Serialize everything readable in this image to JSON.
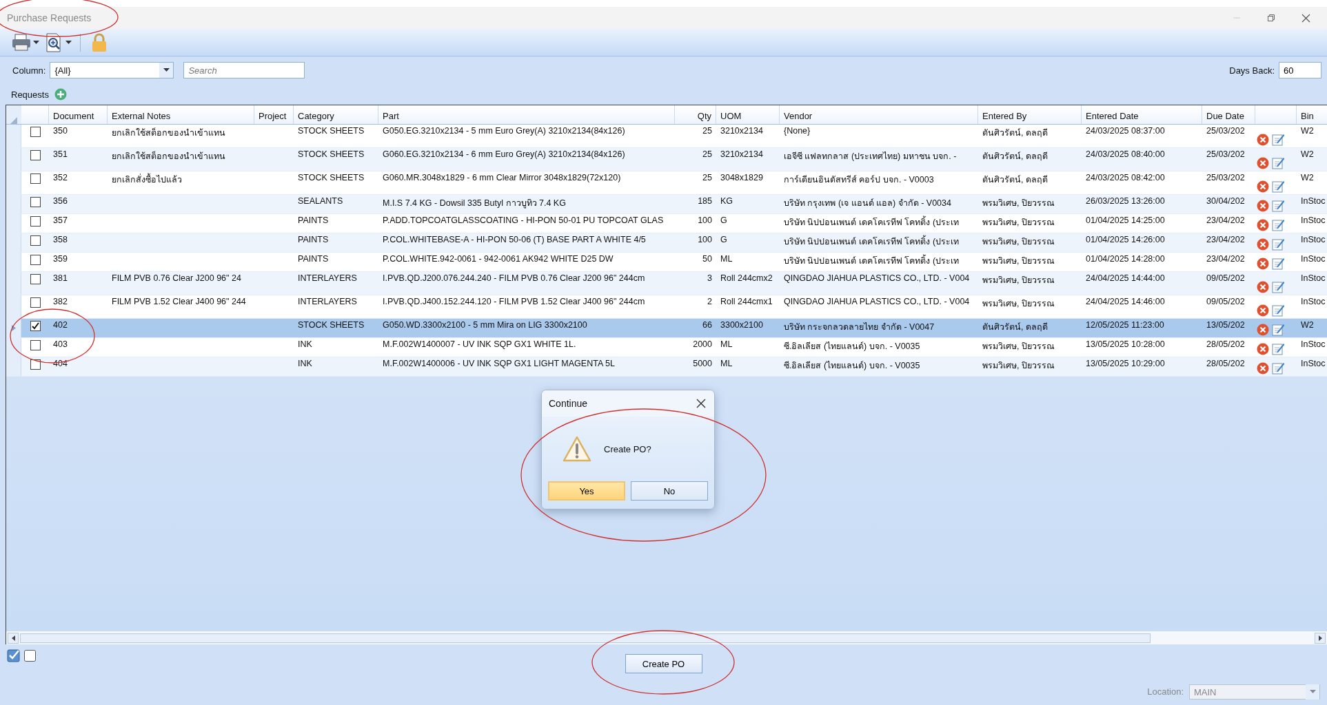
{
  "window": {
    "title": "Purchase Requests",
    "circled": true
  },
  "toolbar": {
    "items": [
      {
        "kind": "print",
        "dropdown": true
      },
      {
        "kind": "preview",
        "dropdown": true
      },
      {
        "kind": "lock",
        "dropdown": false
      }
    ]
  },
  "filter": {
    "column_label": "Column:",
    "column_value": "{All}",
    "search_placeholder": "Search",
    "days_back_label": "Days Back:",
    "days_back_value": "60"
  },
  "requests_label": "Requests",
  "table": {
    "columns": [
      "Document",
      "External Notes",
      "Project",
      "Category",
      "Part",
      "Qty",
      "UOM",
      "Vendor",
      "Entered By",
      "Entered Date",
      "Due Date",
      "Bin"
    ],
    "rows": [
      {
        "document": "350",
        "external_notes": "ยกเลิกใช้สต็อกของนำเข้าแทน",
        "category": "STOCK SHEETS",
        "part": "G050.EG.3210x2134 - 5 mm Euro Grey(A) 3210x2134(84x126)",
        "qty": "25",
        "uom": "3210x2134",
        "vendor": "{None}",
        "entered_by": "ตันศิวรัตน์, ดลฤดี",
        "entered_date": "24/03/2025 08:37:00",
        "due_date": "25/03/202",
        "bin": "W2",
        "checked": false,
        "selected": false,
        "circled": false
      },
      {
        "document": "351",
        "external_notes": "ยกเลิกใช้สต็อกของนำเข้าแทน",
        "category": "STOCK SHEETS",
        "part": "G060.EG.3210x2134 - 6 mm Euro Grey(A) 3210x2134(84x126)",
        "qty": "25",
        "uom": "3210x2134",
        "vendor": "เอจีซี แฟลทกลาส (ประเทศไทย) มหาชน บจก. -",
        "entered_by": "ตันศิวรัตน์, ดลฤดี",
        "entered_date": "24/03/2025 08:40:00",
        "due_date": "25/03/202",
        "bin": "W2",
        "checked": false,
        "selected": false,
        "circled": false
      },
      {
        "document": "352",
        "external_notes": "ยกเลิกสั่งซื้อไปแล้ว",
        "category": "STOCK SHEETS",
        "part": "G060.MR.3048x1829 - 6 mm Clear Mirror 3048x1829(72x120)",
        "qty": "25",
        "uom": "3048x1829",
        "vendor": "การ์เดียนอินดัสทรีส์ คอร์ป บจก. - V0003",
        "entered_by": "ตันศิวรัตน์, ดลฤดี",
        "entered_date": "24/03/2025 08:42:00",
        "due_date": "25/03/202",
        "bin": "W2",
        "checked": false,
        "selected": false,
        "circled": false
      },
      {
        "document": "356",
        "category": "SEALANTS",
        "part": "M.I.S 7.4 KG - Dowsil 335 Butyl กาวบูทิว 7.4 KG",
        "qty": "185",
        "uom": "KG",
        "vendor": "บริษัท กรุงเทพ (เจ แอนด์ แอล) จำกัด - V0034",
        "entered_by": "พรมวิเศษ, ปิยวรรณ",
        "entered_date": "26/03/2025 13:26:00",
        "due_date": "30/04/202",
        "bin": "InStoc",
        "checked": false,
        "selected": false,
        "circled": false
      },
      {
        "document": "357",
        "category": "PAINTS",
        "part": "P.ADD.TOPCOATGLASSCOATING - HI-PON 50-01 PU TOPCOAT GLAS",
        "qty": "100",
        "uom": "G",
        "vendor": "บริษัท นิปปอนเพนต์ เดคโคเรทีฟ โคทติ้ง (ประเท",
        "entered_by": "พรมวิเศษ, ปิยวรรณ",
        "entered_date": "01/04/2025 14:25:00",
        "due_date": "23/04/202",
        "bin": "InStoc",
        "checked": false,
        "selected": false,
        "circled": false
      },
      {
        "document": "358",
        "category": "PAINTS",
        "part": "P.COL.WHITEBASE-A - HI-PON 50-06 (T)  BASE PART A WHITE 4/5",
        "qty": "100",
        "uom": "G",
        "vendor": "บริษัท นิปปอนเพนต์ เดคโคเรทีฟ โคทติ้ง (ประเท",
        "entered_by": "พรมวิเศษ, ปิยวรรณ",
        "entered_date": "01/04/2025 14:26:00",
        "due_date": "23/04/202",
        "bin": "InStoc",
        "checked": false,
        "selected": false,
        "circled": false
      },
      {
        "document": "359",
        "category": "PAINTS",
        "part": "P.COL.WHITE.942-0061 - 942-0061 AK942 WHITE D25 DW",
        "qty": "50",
        "uom": "ML",
        "vendor": "บริษัท นิปปอนเพนต์ เดคโคเรทีฟ โคทติ้ง (ประเท",
        "entered_by": "พรมวิเศษ, ปิยวรรณ",
        "entered_date": "01/04/2025 14:28:00",
        "due_date": "23/04/202",
        "bin": "InStoc",
        "checked": false,
        "selected": false,
        "circled": false
      },
      {
        "document": "381",
        "external_notes": "FILM PVB 0.76 Clear J200  96\" 24",
        "category": "INTERLAYERS",
        "part": "I.PVB.QD.J200.076.244.240 - FILM PVB 0.76 Clear J200  96\" 244cm",
        "qty": "3",
        "uom": "Roll 244cmx2",
        "vendor": "QINGDAO JIAHUA PLASTICS CO., LTD. - V004",
        "entered_by": "พรมวิเศษ, ปิยวรรณ",
        "entered_date": "24/04/2025 14:44:00",
        "due_date": "09/05/202",
        "bin": "InStoc",
        "checked": false,
        "selected": false,
        "circled": false
      },
      {
        "document": "382",
        "external_notes": "FILM PVB 1.52 Clear J400 96\" 244",
        "category": "INTERLAYERS",
        "part": "I.PVB.QD.J400.152.244.120 - FILM PVB 1.52 Clear J400 96\" 244cm",
        "qty": "2",
        "uom": "Roll 244cmx1",
        "vendor": "QINGDAO JIAHUA PLASTICS CO., LTD. - V004",
        "entered_by": "พรมวิเศษ, ปิยวรรณ",
        "entered_date": "24/04/2025 14:46:00",
        "due_date": "09/05/202",
        "bin": "InStoc",
        "checked": false,
        "selected": false,
        "circled": false
      },
      {
        "document": "402",
        "category": "STOCK SHEETS",
        "part": "G050.WD.3300x2100 - 5 mm Mira on LIG 3300x2100",
        "qty": "66",
        "uom": "3300x2100",
        "vendor": "บริษัท กระจกลวดลายไทย จำกัด - V0047",
        "entered_by": "ตันศิวรัตน์, ดลฤดี",
        "entered_date": "12/05/2025 11:23:00",
        "due_date": "13/05/202",
        "bin": "W2",
        "checked": true,
        "selected": true,
        "circled": true
      },
      {
        "document": "403",
        "category": "INK",
        "part": "M.F.002W1400007 - UV INK SQP GX1 WHITE 1L.",
        "qty": "2000",
        "uom": "ML",
        "vendor": "ซี.อิลเลียส (ไทยแลนด์)  บจก. - V0035",
        "entered_by": "พรมวิเศษ, ปิยวรรณ",
        "entered_date": "13/05/2025 10:28:00",
        "due_date": "28/05/202",
        "bin": "InStoc",
        "checked": false,
        "selected": false,
        "circled": false
      },
      {
        "document": "404",
        "category": "INK",
        "part": "M.F.002W1400006 - UV INK SQP GX1 LIGHT MAGENTA 5L",
        "qty": "5000",
        "uom": "ML",
        "vendor": "ซี.อิลเลียส (ไทยแลนด์)  บจก. - V0035",
        "entered_by": "พรมวิเศษ, ปิยวรรณ",
        "entered_date": "13/05/2025 10:29:00",
        "due_date": "28/05/202",
        "bin": "InStoc",
        "checked": false,
        "selected": false,
        "circled": false
      }
    ]
  },
  "dialog": {
    "title": "Continue",
    "message": "Create PO?",
    "circled": true,
    "buttons": [
      {
        "label": "Yes",
        "default": true
      },
      {
        "label": "No",
        "default": false
      }
    ]
  },
  "create_po": {
    "label": "Create PO",
    "circled": true
  },
  "location": {
    "label": "Location:",
    "value": "MAIN",
    "disabled": true
  }
}
